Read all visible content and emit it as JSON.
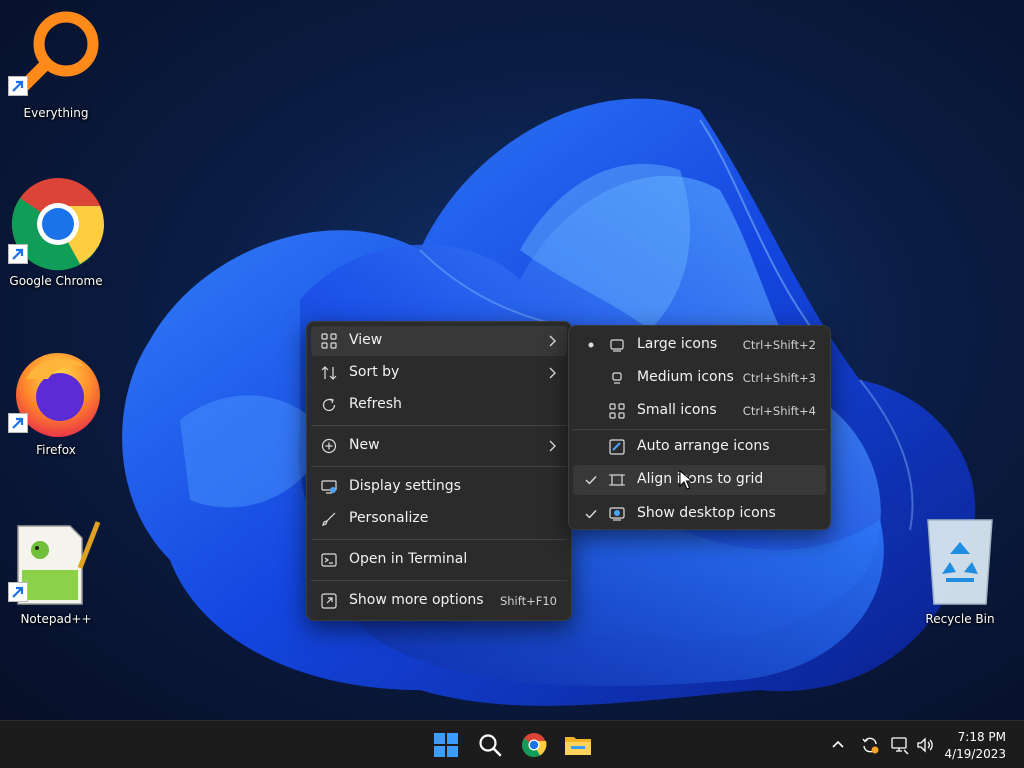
{
  "desktop": {
    "icons": [
      {
        "label": "Everything"
      },
      {
        "label": "Google Chrome"
      },
      {
        "label": "Firefox"
      },
      {
        "label": "Notepad++"
      },
      {
        "label": "Recycle Bin"
      }
    ]
  },
  "context_menu": {
    "items": {
      "view": {
        "label": "View"
      },
      "sort_by": {
        "label": "Sort by"
      },
      "refresh": {
        "label": "Refresh"
      },
      "new": {
        "label": "New"
      },
      "display_settings": {
        "label": "Display settings"
      },
      "personalize": {
        "label": "Personalize"
      },
      "open_terminal": {
        "label": "Open in Terminal"
      },
      "show_more": {
        "label": "Show more options",
        "shortcut": "Shift+F10"
      }
    }
  },
  "view_submenu": {
    "items": {
      "large": {
        "label": "Large icons",
        "shortcut": "Ctrl+Shift+2",
        "selected": true
      },
      "medium": {
        "label": "Medium icons",
        "shortcut": "Ctrl+Shift+3",
        "selected": false
      },
      "small": {
        "label": "Small icons",
        "shortcut": "Ctrl+Shift+4",
        "selected": false
      },
      "auto_arrange": {
        "label": "Auto arrange icons",
        "checked": false
      },
      "align_grid": {
        "label": "Align icons to grid",
        "checked": true
      },
      "show_desktop": {
        "label": "Show desktop icons",
        "checked": true
      }
    }
  },
  "taskbar": {
    "clock": {
      "time": "7:18 PM",
      "date": "4/19/2023"
    }
  },
  "colors": {
    "menu_bg": "#2b2b2b",
    "menu_hover": "#383838",
    "accent_blue": "#1f6fff",
    "taskbar_bg": "#1c1c1c"
  }
}
